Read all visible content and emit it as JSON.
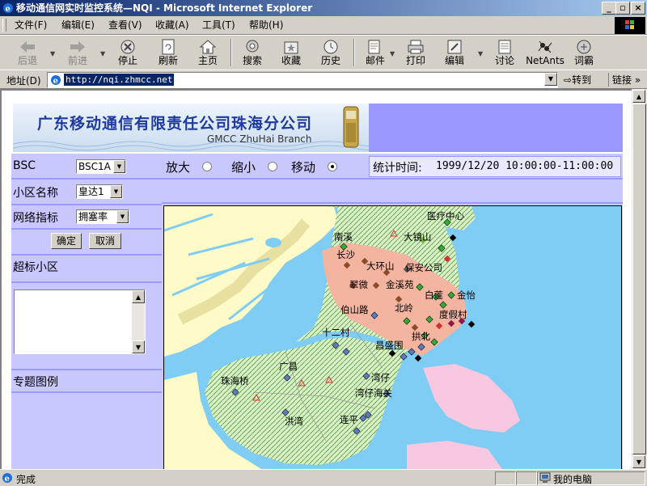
{
  "window": {
    "title": "移动通信网实时监控系统—NQI - Microsoft Internet Explorer"
  },
  "menu": [
    "文件(F)",
    "编辑(E)",
    "查看(V)",
    "收藏(A)",
    "工具(T)",
    "帮助(H)"
  ],
  "toolbar": {
    "back": "后退",
    "forward": "前进",
    "stop": "停止",
    "refresh": "刷新",
    "home": "主页",
    "search": "搜索",
    "favorites": "收藏",
    "history": "历史",
    "mail": "邮件",
    "print": "打印",
    "edit": "编辑",
    "discuss": "讨论",
    "netants": "NetAnts",
    "dictionary": "词霸"
  },
  "address": {
    "label": "地址(D)",
    "url": "http://nqi.zhmcc.net",
    "go": "转到",
    "links": "链接"
  },
  "banner": {
    "cn": "广东移动通信有限责任公司珠海分公司",
    "en": "GMCC ZhuHai Branch"
  },
  "form": {
    "bsc_label": "BSC",
    "bsc_value": "BSC1A",
    "cell_label": "小区名称",
    "cell_value": "皇达1",
    "metric_label": "网络指标",
    "metric_value": "拥塞率",
    "ok": "确定",
    "cancel": "取消",
    "overlimit_label": "超标小区",
    "legend_label": "专题图例"
  },
  "controls": {
    "zoom_in": "放大",
    "zoom_out": "缩小",
    "move": "移动",
    "selected": "移动",
    "stat_label": "统计时间:",
    "stat_time": "1999/12/20 10:00:00-11:00:00"
  },
  "map": {
    "places": [
      "医疗中心",
      "南溪",
      "大镜山",
      "长沙",
      "大环山",
      "保安公司",
      "翠微",
      "金溪苑",
      "白莲",
      "金怡",
      "伯山路",
      "北岭",
      "度假村",
      "十二村",
      "拱北",
      "昌盛围",
      "广昌",
      "湾仔",
      "珠海桥",
      "湾仔海关",
      "洪湾",
      "连平"
    ]
  },
  "status": {
    "text": "完成",
    "zone": "我的电脑"
  }
}
